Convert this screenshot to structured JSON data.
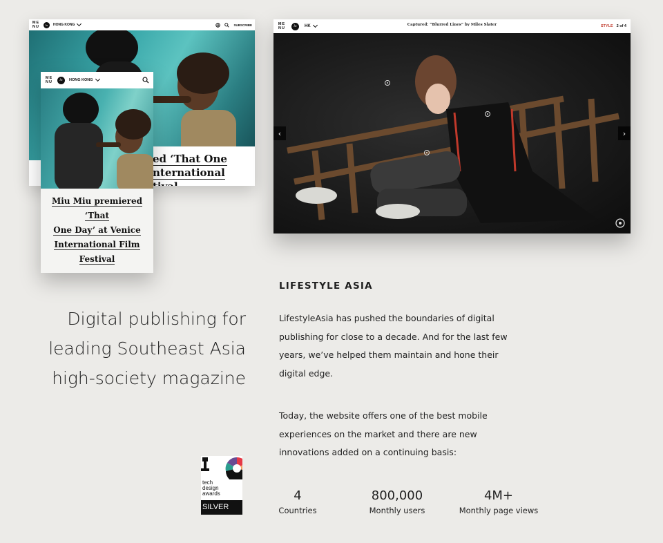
{
  "mockups": {
    "back_screen": {
      "menu_mark": "ME NU",
      "region": "HONG KONG",
      "subscribe": "SUBSCRIBE",
      "headline_fragment": [
        "ed ‘That One",
        "nternational",
        "tival"
      ]
    },
    "front_screen": {
      "menu_mark": "ME NU",
      "region": "HONG KONG",
      "headline_lines": [
        "Miu Miu premiered ‘That",
        "One Day’ at Venice",
        "International Film",
        "Festival"
      ]
    },
    "desktop_screen": {
      "menu_mark": "ME NU",
      "region": "HK",
      "title": "Captured: “Blurred Lines” by Miles Slater",
      "section_link": "STYLE",
      "pager": "2 of 4"
    }
  },
  "tagline": {
    "lines": [
      "Digital publishing for",
      "leading Southeast Asia",
      "high-society magazine"
    ]
  },
  "case_study": {
    "heading": "LIFESTYLE ASIA",
    "paragraph1": [
      "LifestyleAsia has pushed the boundaries of digital",
      "publishing for close to a decade. And for the last few",
      "years, we’ve helped them maintain and hone their",
      "digital edge."
    ],
    "paragraph2": [
      "Today, the website offers one of the best mobile",
      "experiences on the market and there are new",
      "innovations added on a continuing basis:"
    ]
  },
  "stats": [
    {
      "value": "4",
      "label": "Countries"
    },
    {
      "value": "800,000",
      "label": "Monthly users"
    },
    {
      "value": "4M+",
      "label": "Monthly page views"
    }
  ],
  "award": {
    "text_lines": [
      "tech",
      "design",
      "awards"
    ],
    "tier": "SILVER"
  },
  "colors": {
    "background": "#ecebe8",
    "accent_red": "#c0392b",
    "teal_photo": "#3aa8aa"
  }
}
